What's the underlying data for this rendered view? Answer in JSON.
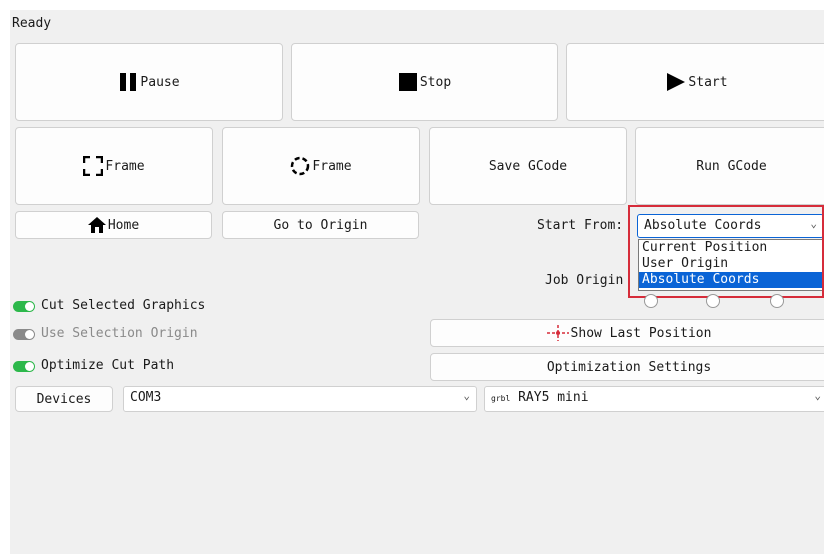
{
  "status": "Ready",
  "buttons": {
    "pause": "Pause",
    "stop": "Stop",
    "start": "Start",
    "frame_rect": "Frame",
    "frame_circle": "Frame",
    "save_gcode": "Save GCode",
    "run_gcode": "Run GCode",
    "home": "Home",
    "go_to_origin": "Go to Origin",
    "show_last_position": "Show Last Position",
    "optimization_settings": "Optimization Settings",
    "devices": "Devices"
  },
  "start_from": {
    "label": "Start From:",
    "value": "Absolute Coords",
    "options": [
      "Current Position",
      "User Origin",
      "Absolute Coords"
    ],
    "selected_index": 2
  },
  "job_origin": {
    "label": "Job Origin"
  },
  "toggles": {
    "cut_selected": {
      "label": "Cut Selected Graphics",
      "on": true
    },
    "use_selection_origin": {
      "label": "Use Selection Origin",
      "on": false,
      "disabled": true
    },
    "optimize_cut_path": {
      "label": "Optimize Cut Path",
      "on": true
    }
  },
  "port": {
    "value": "COM3"
  },
  "device_profile": {
    "prefix": "grbl",
    "value": "RAY5 mini"
  },
  "colors": {
    "toggle_on": "#2db84b",
    "toggle_off": "#8a8a8a",
    "highlight": "#d62c3a",
    "selection": "#0a64d6"
  }
}
